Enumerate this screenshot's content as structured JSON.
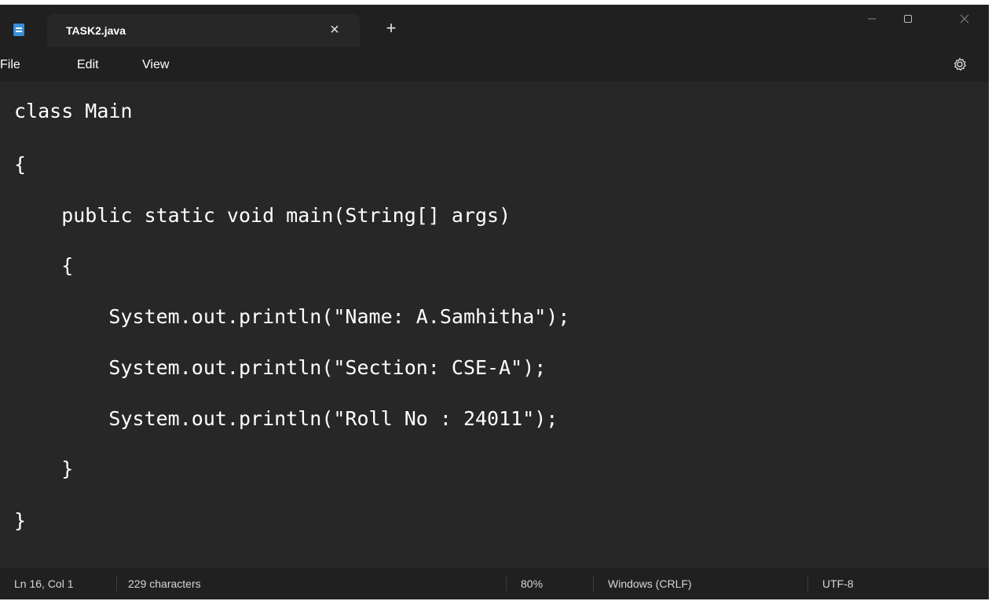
{
  "tab": {
    "title": "TASK2.java",
    "close_glyph": "×",
    "new_tab_glyph": "+"
  },
  "icons": {
    "app": "notepad-icon",
    "settings": "gear-icon",
    "minimize": "minimize-icon",
    "maximize": "maximize-icon",
    "close": "close-icon"
  },
  "menu": {
    "file": "File",
    "edit": "Edit",
    "view": "View"
  },
  "editor": {
    "lines": [
      "class Main",
      "{",
      "    public static void main(String[] args)",
      "    {",
      "        System.out.println(\"Name: A.Samhitha\");",
      "        System.out.println(\"Section: CSE-A\");",
      "        System.out.println(\"Roll No : 24011\");",
      "    }",
      "}"
    ]
  },
  "status": {
    "position": "Ln 16, Col 1",
    "characters": "229 characters",
    "zoom": "80%",
    "line_endings": "Windows (CRLF)",
    "encoding": "UTF-8"
  },
  "colors": {
    "window_bg": "#272727",
    "chrome_bg": "#202020",
    "text": "#ffffff",
    "accent": "#3a8fd8"
  }
}
